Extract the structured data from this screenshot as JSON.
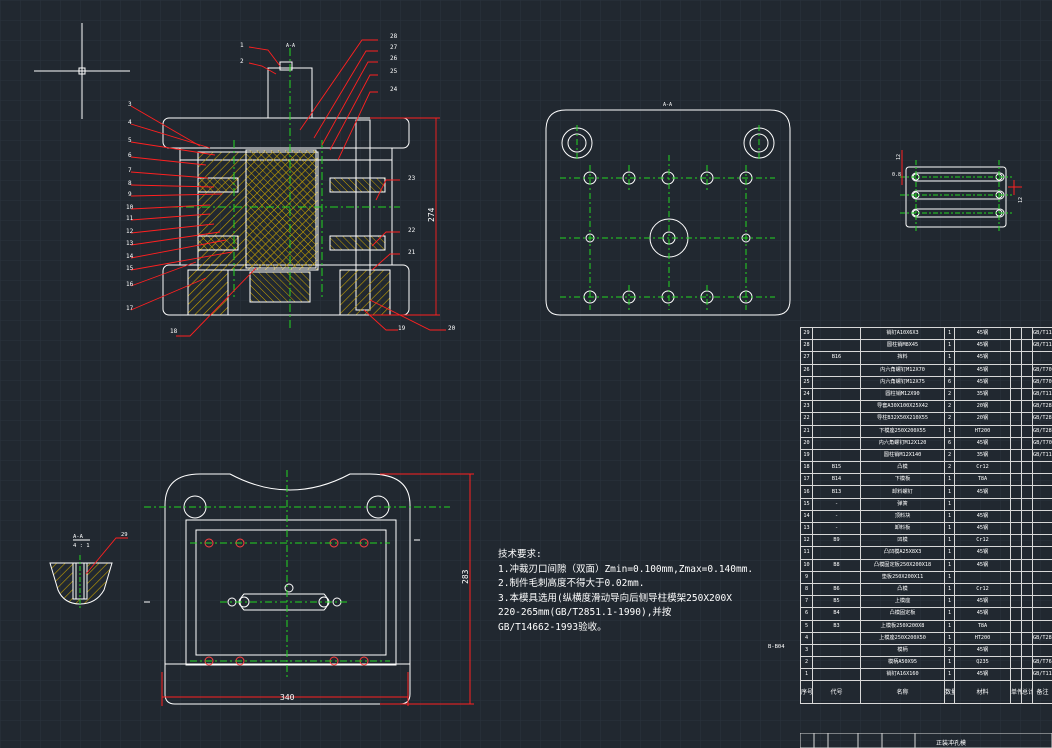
{
  "app": {
    "name": "CAD drawing viewer"
  },
  "colors": {
    "background": "#212830",
    "grid_minor": "#27303a",
    "grid_major": "#2f3945",
    "outline": "#ffffff",
    "center_line": "#22d622",
    "leader": "#ff2020",
    "hatch": "#d4b000",
    "dimension": "#ff3030",
    "text": "#ffffff"
  },
  "drawing": {
    "main_view": {
      "top_label": "A-A",
      "dimension_height": "274",
      "part_numbers_left": [
        "1",
        "2",
        "3",
        "4",
        "5",
        "6",
        "7",
        "8",
        "9",
        "10",
        "11",
        "12",
        "13",
        "14",
        "15",
        "16",
        "17",
        "18"
      ],
      "part_numbers_right": [
        "28",
        "27",
        "26",
        "25",
        "24",
        "23",
        "22",
        "21",
        "20",
        "19"
      ]
    },
    "top_view": {
      "label": "A-A"
    },
    "small_view": {
      "dim_top": "12",
      "dim_left": "0.8",
      "dim_right": "12"
    },
    "plan_view": {
      "dimension_width": "340",
      "dimension_height": "283"
    },
    "detail_view": {
      "label": "A-A",
      "scale": "4 : 1",
      "part_number": "29"
    },
    "side_tag": "B-B04"
  },
  "technical_notes": {
    "title": "技术要求:",
    "lines": [
      "1.冲裁刃口间隙（双面）Zmin=0.100mm,Zmax=0.140mm.",
      "2.制件毛刺高度不得大于0.02mm.",
      "3.本模具选用(纵横度滑动导向后侧导柱模架250X200X",
      "220-265mm(GB/T2851.1-1990),并按",
      "GB/T14662-1993验收。"
    ]
  },
  "bom": {
    "rows": [
      {
        "no": "29",
        "code": "",
        "name": "销钉A10X6X3",
        "qty": "1",
        "mat": "45钢",
        "note": "GB/T119.1"
      },
      {
        "no": "28",
        "code": "",
        "name": "圆柱销M8X45",
        "qty": "1",
        "mat": "45钢",
        "note": "GB/T119"
      },
      {
        "no": "27",
        "code": "B16",
        "name": "挡料",
        "qty": "1",
        "mat": "45钢",
        "note": ""
      },
      {
        "no": "26",
        "code": "",
        "name": "内六角螺钉M12X70",
        "qty": "4",
        "mat": "45钢",
        "note": "GB/T70.1"
      },
      {
        "no": "25",
        "code": "",
        "name": "内六角螺钉M12X75",
        "qty": "6",
        "mat": "45钢",
        "note": "GB/T70.1"
      },
      {
        "no": "24",
        "code": "",
        "name": "圆柱销M12X90",
        "qty": "2",
        "mat": "35钢",
        "note": "GB/T119"
      },
      {
        "no": "23",
        "code": "",
        "name": "导套A30X100X25X42",
        "qty": "2",
        "mat": "20钢",
        "note": "GB/T2861"
      },
      {
        "no": "22",
        "code": "",
        "name": "导柱B32X50X210X55",
        "qty": "2",
        "mat": "20钢",
        "note": "GB/T2861"
      },
      {
        "no": "21",
        "code": "",
        "name": "下模座250X200X55",
        "qty": "1",
        "mat": "HT200",
        "note": "GB/T2855"
      },
      {
        "no": "20",
        "code": "",
        "name": "内六角螺钉M12X120",
        "qty": "6",
        "mat": "45钢",
        "note": "GB/T70"
      },
      {
        "no": "19",
        "code": "",
        "name": "圆柱销M12X140",
        "qty": "2",
        "mat": "35钢",
        "note": "GB/T119"
      },
      {
        "no": "18",
        "code": "B15",
        "name": "凸模",
        "qty": "2",
        "mat": "Cr12",
        "note": ""
      },
      {
        "no": "17",
        "code": "B14",
        "name": "下模板",
        "qty": "1",
        "mat": "T8A",
        "note": ""
      },
      {
        "no": "16",
        "code": "B13",
        "name": "卸料螺钉",
        "qty": "1",
        "mat": "45钢",
        "note": ""
      },
      {
        "no": "15",
        "code": "-",
        "name": "弹簧",
        "qty": "1",
        "mat": "",
        "note": ""
      },
      {
        "no": "14",
        "code": "-",
        "name": "顶料块",
        "qty": "1",
        "mat": "45钢",
        "note": ""
      },
      {
        "no": "13",
        "code": "-",
        "name": "卸料板",
        "qty": "1",
        "mat": "45钢",
        "note": ""
      },
      {
        "no": "12",
        "code": "B9",
        "name": "凹模",
        "qty": "1",
        "mat": "Cr12",
        "note": ""
      },
      {
        "no": "11",
        "code": "",
        "name": "凸凹模A25X8X3",
        "qty": "1",
        "mat": "45钢",
        "note": ""
      },
      {
        "no": "10",
        "code": "B8",
        "name": "凸模固定板250X200X18",
        "qty": "1",
        "mat": "45钢",
        "note": ""
      },
      {
        "no": "9",
        "code": "",
        "name": "垫板250X200X11",
        "qty": "1",
        "mat": "",
        "note": ""
      },
      {
        "no": "8",
        "code": "B6",
        "name": "凸模",
        "qty": "1",
        "mat": "Cr12",
        "note": ""
      },
      {
        "no": "7",
        "code": "B5",
        "name": "上模座",
        "qty": "1",
        "mat": "45钢",
        "note": ""
      },
      {
        "no": "6",
        "code": "B4",
        "name": "凸模固定板",
        "qty": "1",
        "mat": "45钢",
        "note": ""
      },
      {
        "no": "5",
        "code": "B3",
        "name": "上模板250X200X8",
        "qty": "1",
        "mat": "T8A",
        "note": ""
      },
      {
        "no": "4",
        "code": "",
        "name": "上模座250X200X50",
        "qty": "1",
        "mat": "HT200",
        "note": "GB/T2855"
      },
      {
        "no": "3",
        "code": "",
        "name": "模柄",
        "qty": "2",
        "mat": "45钢",
        "note": ""
      },
      {
        "no": "2",
        "code": "",
        "name": "模柄A50X95",
        "qty": "1",
        "mat": "Q235",
        "note": "GB/T7646"
      },
      {
        "no": "1",
        "code": "",
        "name": "销钉A16X160",
        "qty": "1",
        "mat": "45钢",
        "note": "GB/T119"
      }
    ],
    "header": {
      "no": "序号",
      "code": "代号",
      "name": "名称",
      "qty": "数量",
      "mat": "材料",
      "w1": "单件",
      "w2": "总计",
      "weight": "重量",
      "note": "备注"
    }
  },
  "title_block": {
    "caption": "正装冲孔模"
  }
}
